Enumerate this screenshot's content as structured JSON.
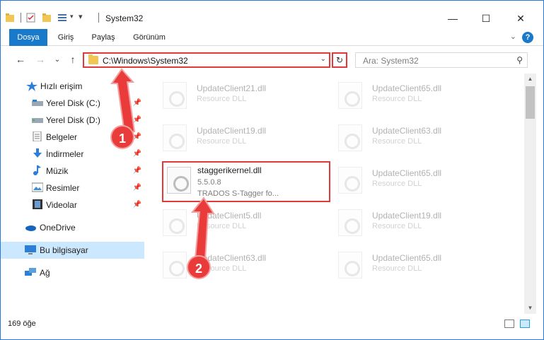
{
  "titlebar": {
    "title": "System32",
    "minimize_icon": "minimize-icon",
    "maximize_icon": "maximize-icon",
    "close_icon": "close-icon"
  },
  "ribbon": {
    "tabs": [
      {
        "label": "Dosya",
        "active": true
      },
      {
        "label": "Giriş",
        "active": false
      },
      {
        "label": "Paylaş",
        "active": false
      },
      {
        "label": "Görünüm",
        "active": false
      }
    ],
    "help": "?"
  },
  "address": {
    "path": "C:\\Windows\\System32",
    "search_placeholder": "Ara: System32"
  },
  "sidebar": {
    "quick_access": "Hızlı erişim",
    "items": [
      {
        "label": "Yerel Disk (C:)",
        "icon": "drive-icon",
        "pinned": true
      },
      {
        "label": "Yerel Disk (D:)",
        "icon": "drive-icon",
        "pinned": true
      },
      {
        "label": "Belgeler",
        "icon": "documents-icon",
        "pinned": true
      },
      {
        "label": "İndirmeler",
        "icon": "downloads-icon",
        "pinned": true
      },
      {
        "label": "Müzik",
        "icon": "music-icon",
        "pinned": true
      },
      {
        "label": "Resimler",
        "icon": "pictures-icon",
        "pinned": true
      },
      {
        "label": "Videolar",
        "icon": "videos-icon",
        "pinned": true
      }
    ],
    "onedrive": "OneDrive",
    "this_pc": "Bu bilgisayar",
    "network": "Ağ"
  },
  "files": {
    "left": [
      {
        "name": "UpdateClient21.dll",
        "desc": "Resource DLL"
      },
      {
        "name": "UpdateClient19.dll",
        "desc": "Resource DLL"
      },
      {
        "name": "staggerikernel.dll",
        "desc": "5.5.0.8",
        "desc2": "TRADOS S-Tagger fo..."
      },
      {
        "name": "UpdateClient5.dll",
        "desc": "Resource DLL"
      },
      {
        "name": "UpdateClient63.dll",
        "desc": "Resource DLL"
      }
    ],
    "right": [
      {
        "name": "UpdateClient65.dll",
        "desc": "Resource DLL"
      },
      {
        "name": "UpdateClient63.dll",
        "desc": "Resource DLL"
      },
      {
        "name": "UpdateClient65.dll",
        "desc": "Resource DLL"
      },
      {
        "name": "UpdateClient19.dll",
        "desc": "Resource DLL"
      },
      {
        "name": "UpdateClient65.dll",
        "desc": "Resource DLL"
      }
    ]
  },
  "status": {
    "count": "169 öğe"
  },
  "annotations": {
    "step1": "1",
    "step2": "2",
    "color": "#ea3b3b"
  }
}
